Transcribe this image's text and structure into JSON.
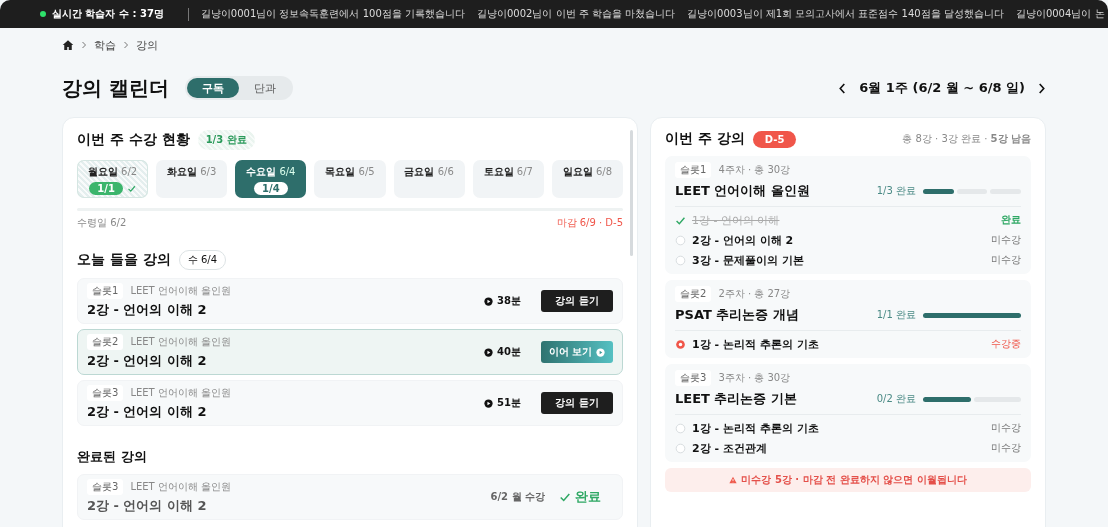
{
  "ticker": {
    "live_label": "실시간 학습자 수 : 37명",
    "messages": [
      "길냥이0001님이 정보속독훈련에서 100점을 기록했습니다",
      "길냥이0002님이 이번 주 학습을 마쳤습니다",
      "길냥이0003님이 제1회 모의고사에서 표준점수 140점을 달성했습니다",
      "길냥이0004님이 논"
    ]
  },
  "breadcrumb": [
    "학습",
    "강의"
  ],
  "header": {
    "title": "강의 캘린더",
    "toggle": [
      {
        "label": "구독",
        "selected": true
      },
      {
        "label": "단과",
        "selected": false
      }
    ],
    "week": "6월 1주 (6/2 월 ~ 6/8 일)"
  },
  "weekly_status": {
    "title": "이번 주 수강 현황",
    "badge": "1/3 완료",
    "days": [
      {
        "day": "월요일",
        "date": "6/2",
        "selected": false,
        "completed": true,
        "count": "1/1"
      },
      {
        "day": "화요일",
        "date": "6/3",
        "selected": false,
        "completed": false
      },
      {
        "day": "수요일",
        "date": "6/4",
        "selected": true,
        "completed": false,
        "count": "1/4"
      },
      {
        "day": "목요일",
        "date": "6/5",
        "selected": false,
        "completed": false
      },
      {
        "day": "금요일",
        "date": "6/6",
        "selected": false,
        "completed": false
      },
      {
        "day": "토요일",
        "date": "6/7",
        "selected": false,
        "completed": false
      },
      {
        "day": "일요일",
        "date": "6/8",
        "selected": false,
        "completed": false
      }
    ],
    "start": "수령일 6/2",
    "deadline": "마감 6/9 · D-5"
  },
  "today": {
    "title": "오늘 들을 강의",
    "badge": "수 6/4",
    "lectures": [
      {
        "slot": "슬롯1",
        "course": "LEET 언어이해 올인원",
        "title": "2강 - 언어의 이해 2",
        "duration": "38분",
        "button": "강의 듣기",
        "selected": false
      },
      {
        "slot": "슬롯2",
        "course": "LEET 언어이해 올인원",
        "title": "2강 - 언어의 이해 2",
        "duration": "40분",
        "button": "이어 보기",
        "selected": true
      },
      {
        "slot": "슬롯3",
        "course": "LEET 언어이해 올인원",
        "title": "2강 - 언어의 이해 2",
        "duration": "51분",
        "button": "강의 듣기",
        "selected": false
      }
    ]
  },
  "completed": {
    "title": "완료된 강의",
    "lectures": [
      {
        "slot": "슬롯3",
        "course": "LEET 언어이해 올인원",
        "title": "2강 - 언어의 이해 2",
        "date": "6/2 월 수강",
        "status": "완료"
      }
    ]
  },
  "week_lectures": {
    "title": "이번 주 강의",
    "badge": "D-5",
    "summary": "총 8강 · 3강 완료 · **5강 남음**",
    "slots": [
      {
        "slot": "슬롯1",
        "meta": "4주차 · 총 30강",
        "course": "LEET 언어이해 올인원",
        "progress": "1/3 완료",
        "segments": [
          {
            "filled": true
          },
          {
            "filled": false
          },
          {
            "filled": false
          }
        ],
        "lectures": [
          {
            "title": "1강 - 언어의 이해",
            "kind": "done",
            "label": "완료"
          },
          {
            "title": "2강 - 언어의 이해 2",
            "kind": "todo",
            "label": "미수강"
          },
          {
            "title": "3강 - 문제풀이의 기본",
            "kind": "todo",
            "label": "미수강"
          }
        ]
      },
      {
        "slot": "슬롯2",
        "meta": "2주차 · 총 27강",
        "course": "PSAT 추리논증 개념",
        "progress": "1/1 완료",
        "segments": [
          {
            "filled": true
          }
        ],
        "lectures": [
          {
            "title": "1강 - 논리적 추론의 기초",
            "kind": "current",
            "label": "수강중"
          }
        ]
      },
      {
        "slot": "슬롯3",
        "meta": "3주차 · 총 30강",
        "course": "LEET 추리논증 기본",
        "progress": "0/2 완료",
        "segments": [
          {
            "filled": true
          },
          {
            "filled": false
          }
        ],
        "lectures": [
          {
            "title": "1강 - 논리적 추론의 기초",
            "kind": "todo",
            "label": "미수강"
          },
          {
            "title": "2강 - 조건관계",
            "kind": "todo",
            "label": "미수강"
          }
        ]
      }
    ],
    "warning": "미수강 5강 · 마감 전 완료하지 않으면 이월됩니다"
  }
}
